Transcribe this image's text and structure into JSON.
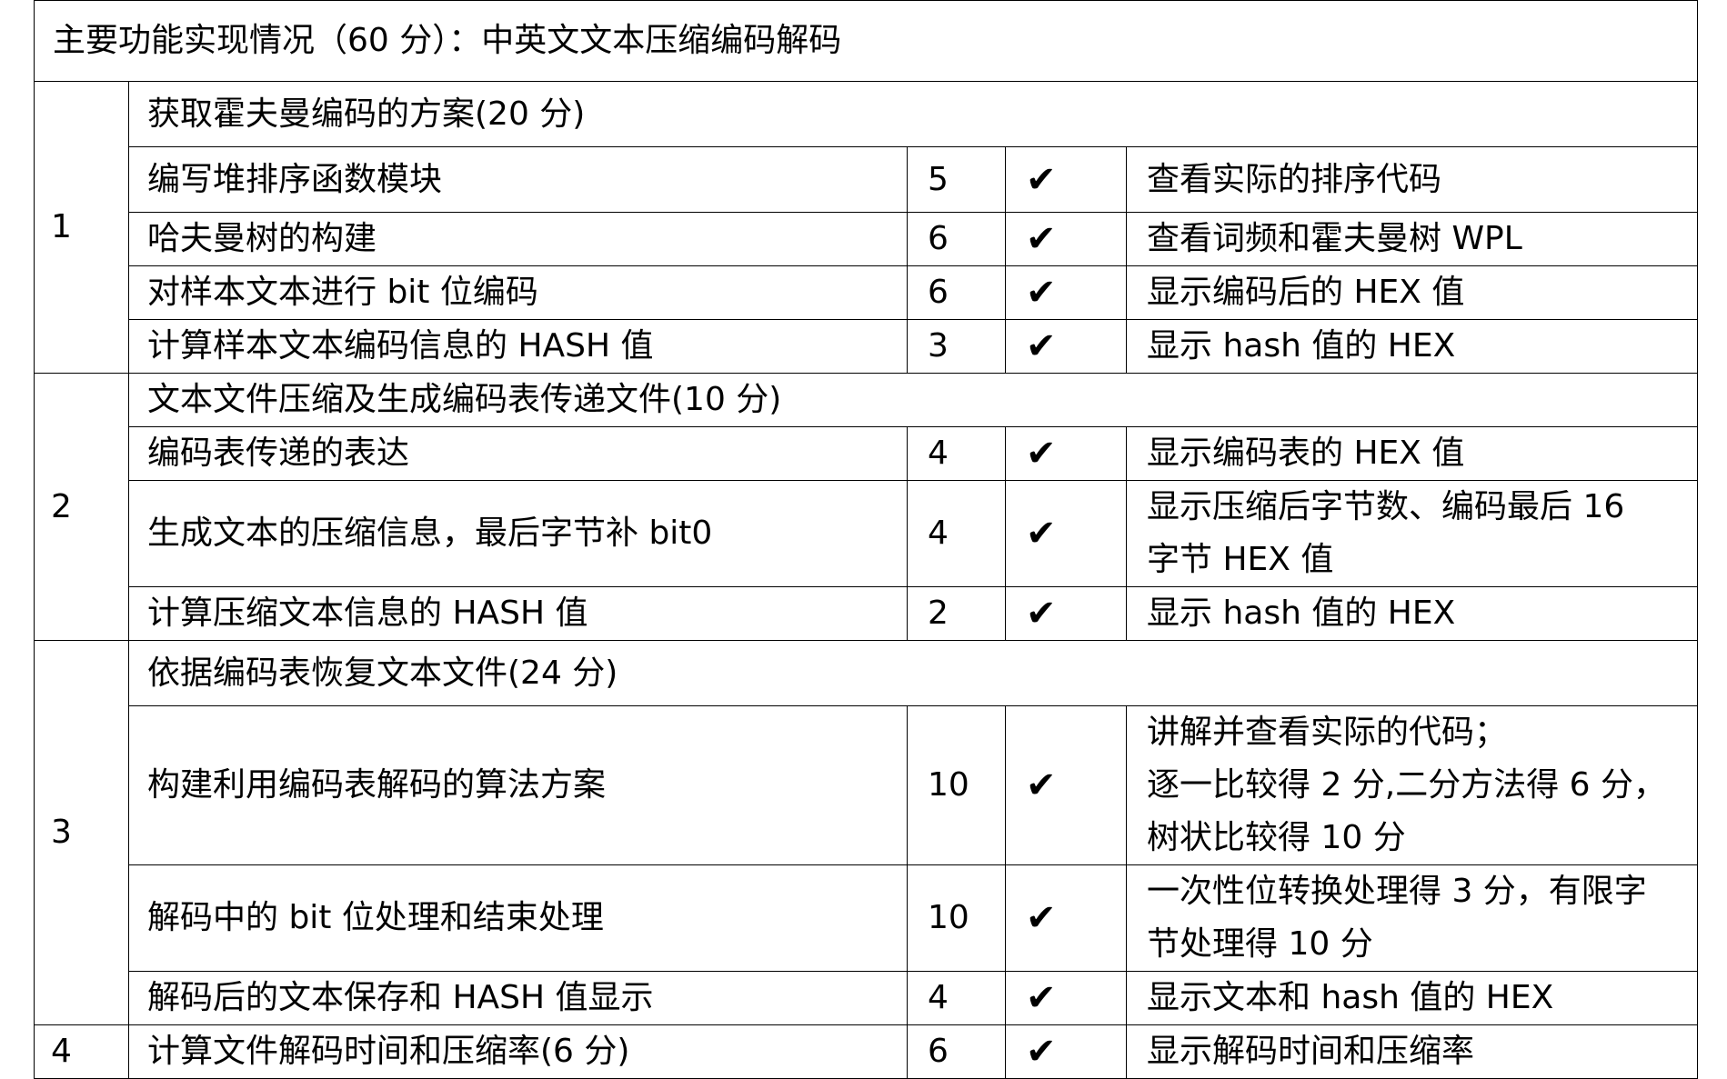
{
  "header": "主要功能实现情况（60 分）：中英文文本压缩编码解码",
  "check_mark": "✔",
  "groups": [
    {
      "no": "1",
      "section": "获取霍夫曼编码的方案(20 分)",
      "items": [
        {
          "task": "编写堆排序函数模块",
          "points": "5",
          "note_lines": [
            "查看实际的排序代码"
          ]
        },
        {
          "task": "哈夫曼树的构建",
          "points": "6",
          "note_lines": [
            "查看词频和霍夫曼树 WPL"
          ]
        },
        {
          "task": "对样本文本进行 bit 位编码",
          "points": "6",
          "note_lines": [
            "显示编码后的 HEX 值"
          ]
        },
        {
          "task": "计算样本文本编码信息的 HASH 值",
          "points": "3",
          "note_lines": [
            "显示 hash 值的 HEX"
          ]
        }
      ]
    },
    {
      "no": "2",
      "section": "文本文件压缩及生成编码表传递文件(10 分)",
      "items": [
        {
          "task": "编码表传递的表达",
          "points": "4",
          "note_lines": [
            "显示编码表的 HEX 值"
          ]
        },
        {
          "task": "生成文本的压缩信息，最后字节补 bit0",
          "points": "4",
          "note_lines": [
            "显示压缩后字节数、编码最后 16",
            "字节 HEX 值"
          ]
        },
        {
          "task": "计算压缩文本信息的 HASH 值",
          "points": "2",
          "note_lines": [
            "显示 hash 值的 HEX"
          ]
        }
      ]
    },
    {
      "no": "3",
      "section": "依据编码表恢复文本文件(24 分)",
      "items": [
        {
          "task": "构建利用编码表解码的算法方案",
          "points": "10",
          "note_lines": [
            "讲解并查看实际的代码；",
            "逐一比较得 2 分,二分方法得 6 分，",
            "树状比较得 10 分"
          ]
        },
        {
          "task": "解码中的 bit 位处理和结束处理",
          "points": "10",
          "note_lines": [
            "一次性位转换处理得 3 分，有限字",
            "节处理得 10 分"
          ]
        },
        {
          "task": "解码后的文本保存和 HASH 值显示",
          "points": "4",
          "note_lines": [
            "显示文本和 hash 值的 HEX"
          ]
        }
      ]
    },
    {
      "no": "4",
      "section": "",
      "items": [
        {
          "task": "计算文件解码时间和压缩率(6 分)",
          "points": "6",
          "note_lines": [
            "显示解码时间和压缩率"
          ]
        }
      ]
    }
  ]
}
